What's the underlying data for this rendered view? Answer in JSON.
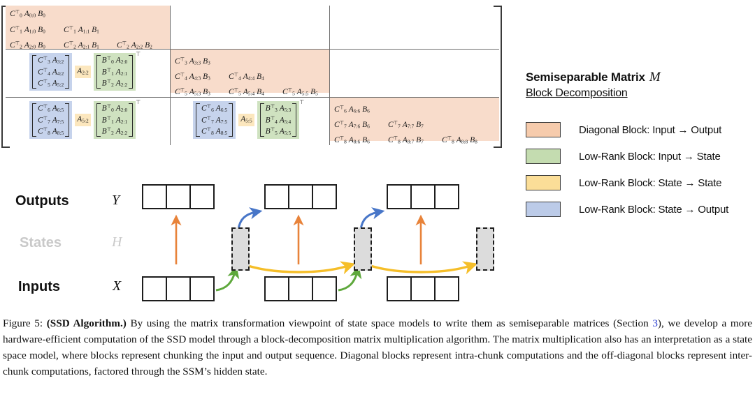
{
  "matrix": {
    "blocks": [
      {
        "id": "diag-0",
        "type": "diagonal",
        "rows": [
          [
            "C0⊤ A0:0 B0"
          ],
          [
            "C1⊤ A1:0 B0",
            "C1⊤ A1:1 B1"
          ],
          [
            "C2⊤ A2:0 B0",
            "C2⊤ A2:1 B1",
            "C2⊤ A2:2 B2"
          ]
        ]
      },
      {
        "id": "diag-1",
        "type": "diagonal",
        "rows": [
          [
            "C3⊤ A3:3 B3"
          ],
          [
            "C4⊤ A4:3 B3",
            "C4⊤ A4:4 B4"
          ],
          [
            "C5⊤ A5:3 B3",
            "C5⊤ A5:4 B4",
            "C5⊤ A5:5 B5"
          ]
        ]
      },
      {
        "id": "diag-2",
        "type": "diagonal",
        "rows": [
          [
            "C6⊤ A6:6 B6"
          ],
          [
            "C7⊤ A7:6 B6",
            "C7⊤ A7:7 B7"
          ],
          [
            "C8⊤ A8:6 B6",
            "C8⊤ A8:7 B7",
            "C8⊤ A8:8 B8"
          ]
        ]
      }
    ],
    "lowrank": [
      {
        "id": "lowrank-r1c0",
        "C": [
          "C3⊤ A3:2",
          "C4⊤ A4:2",
          "C5⊤ A5:2"
        ],
        "A": "A2:2",
        "B": [
          "B0⊤ A2:0",
          "B1⊤ A2:1",
          "B2⊤ A2:2"
        ],
        "transpose": "⊤"
      },
      {
        "id": "lowrank-r2c0",
        "C": [
          "C6⊤ A6:5",
          "C7⊤ A7:5",
          "C8⊤ A8:5"
        ],
        "A": "A5:2",
        "B": [
          "B0⊤ A2:0",
          "B1⊤ A2:1",
          "B2⊤ A2:2"
        ],
        "transpose": "⊤"
      },
      {
        "id": "lowrank-r2c1",
        "C": [
          "C6⊤ A6:5",
          "C7⊤ A7:5",
          "C8⊤ A8:5"
        ],
        "A": "A5:5",
        "B": [
          "B3⊤ A5:3",
          "B4⊤ A5:4",
          "B5⊤ A5:5"
        ],
        "transpose": "⊤"
      }
    ]
  },
  "legend": {
    "title": "Semiseparable Matrix",
    "title_var": "M",
    "subtitle": "Block Decomposition",
    "items": [
      {
        "label": "Diagonal Block: Input → Output",
        "color": "#F6CBAC",
        "swatch_name": "diagonal-block-swatch"
      },
      {
        "label": "Low-Rank Block: Input → State",
        "color": "#C4DCB0",
        "swatch_name": "input-to-state-swatch"
      },
      {
        "label": "Low-Rank Block: State → State",
        "color": "#FBDE98",
        "swatch_name": "state-to-state-swatch"
      },
      {
        "label": "Low-Rank Block: State → Output",
        "color": "#BCCBE8",
        "swatch_name": "state-to-output-swatch"
      }
    ]
  },
  "diagram": {
    "rows": [
      {
        "label": "Outputs",
        "var": "Y",
        "muted": false
      },
      {
        "label": "States",
        "var": "H",
        "muted": true
      },
      {
        "label": "Inputs",
        "var": "X",
        "muted": false
      }
    ],
    "chunk_count": 3,
    "cells_per_chunk": 3,
    "state_count": 3,
    "arrow_colors": {
      "diagonal": "#E8833A",
      "input_to_state": "#5EA83C",
      "state_to_state": "#F5BE29",
      "state_to_output": "#4876C8"
    }
  },
  "caption": {
    "figure_number": "Figure 5:",
    "bold_lead": "(SSD Algorithm.)",
    "text_1": " By using the matrix transformation viewpoint of state space models to write them as semiseparable matrices (Section ",
    "section_link": "3",
    "text_2": "), we develop a more hardware-efficient computation of the SSD model through a block-decomposition matrix multiplication algorithm. The matrix multiplication also has an interpretation as a state space model, where blocks represent chunking the input and output sequence. Diagonal blocks represent intra-chunk computations and the off-diagonal blocks represent inter-chunk computations, factored through the SSM’s hidden state."
  }
}
